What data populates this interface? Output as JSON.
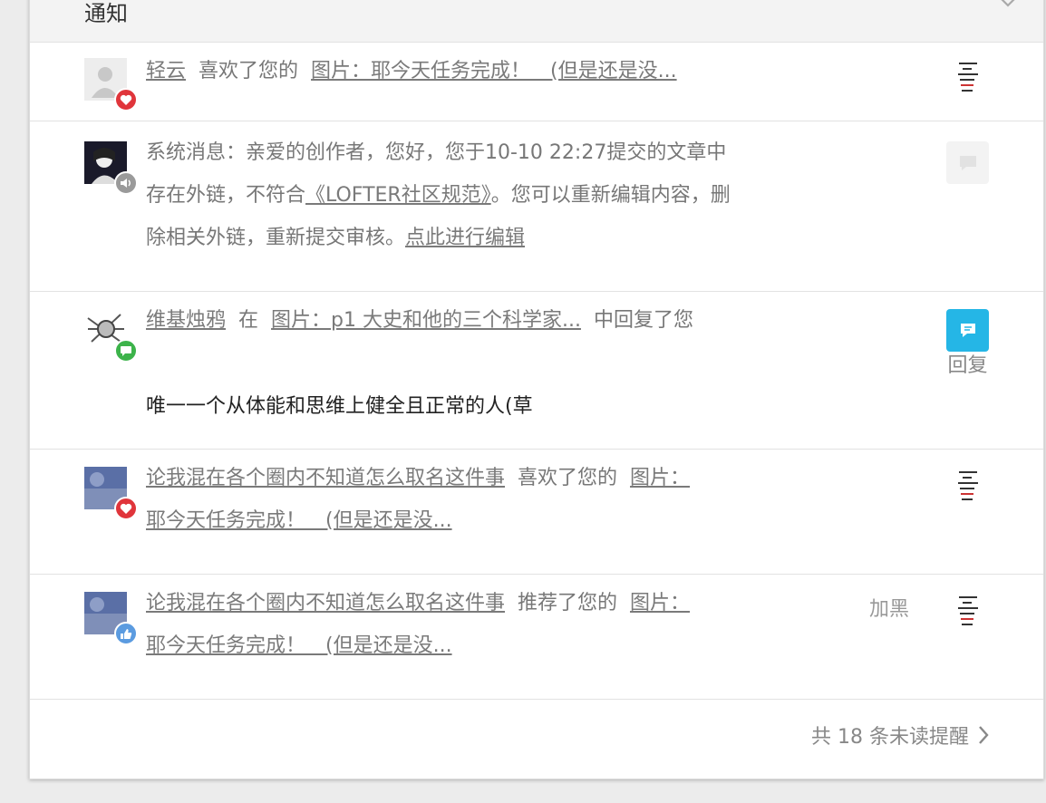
{
  "header": {
    "title": "通知"
  },
  "notifications": [
    {
      "user": "轻云",
      "action": "喜欢了您的",
      "post_link": "图片：耶今天任务完成！　(但是还是没..."
    },
    {
      "system_prefix": "系统消息：亲爱的创作者，您好，您于10-10 22:27提交的文章中存在外链，不符合",
      "rules_link": "《LOFTER社区规范》",
      "system_mid": "。您可以重新编辑内容，删除相关外链，重新提交审核。",
      "edit_link": "点此进行编辑"
    },
    {
      "user": "维基烛鸦",
      "pre": "在",
      "post_link": "图片：p1 大史和他的三个科学家...",
      "action": "中回复了您",
      "comment": "唯一一个从体能和思维上健全且正常的人(草",
      "reply_label": "回复"
    },
    {
      "user": "论我混在各个圈内不知道怎么取名这件事",
      "action": "喜欢了您的",
      "post_link_a": "图片：",
      "post_link_b": "耶今天任务完成！　(但是还是没..."
    },
    {
      "user": "论我混在各个圈内不知道怎么取名这件事",
      "action": "推荐了您的",
      "post_link_a": "图片：",
      "post_link_b": "耶今天任务完成！　(但是还是没...",
      "block_label": "加黑"
    }
  ],
  "footer": {
    "unread_text": "共 18 条未读提醒"
  },
  "colors": {
    "like_badge": "#e0353b",
    "comment_badge": "#3cb34a",
    "recommend_badge": "#5b9be0",
    "system_badge": "#9a9a9a",
    "reply_button": "#25b6e6"
  },
  "icons": [
    "close-icon",
    "heart-icon",
    "speaker-icon",
    "comment-icon",
    "thumbs-up-icon",
    "chevron-right-icon"
  ]
}
